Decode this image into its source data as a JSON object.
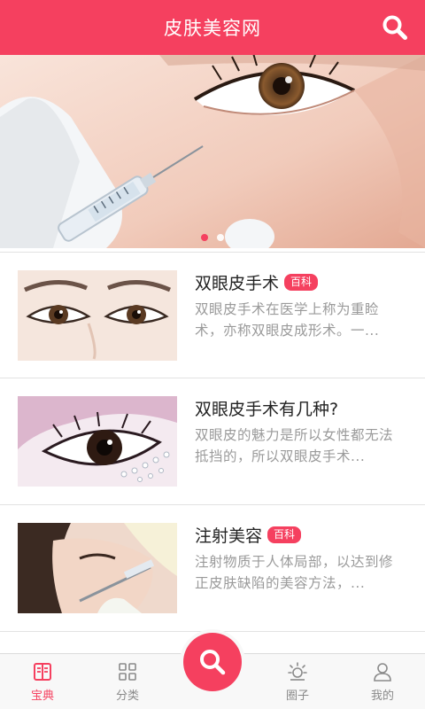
{
  "header": {
    "title": "皮肤美容网",
    "search_icon": "search-icon"
  },
  "banner": {
    "dots": 2,
    "active_index": 0
  },
  "articles": [
    {
      "title": "双眼皮手术",
      "badge": "百科",
      "desc": "双眼皮手术在医学上称为重睑术，亦称双眼皮成形术。一..."
    },
    {
      "title": "双眼皮手术有几种?",
      "badge": "",
      "desc": "双眼皮的魅力是所以女性都无法抵挡的，所以双眼皮手术..."
    },
    {
      "title": "注射美容",
      "badge": "百科",
      "desc": "注射物质于人体局部，以达到修正皮肤缺陷的美容方法，..."
    }
  ],
  "tabbar": {
    "tabs": [
      {
        "label": "宝典",
        "icon": "book-icon",
        "active": true
      },
      {
        "label": "分类",
        "icon": "grid-icon",
        "active": false
      },
      {
        "label": "圈子",
        "icon": "sun-icon",
        "active": false
      },
      {
        "label": "我的",
        "icon": "user-icon",
        "active": false
      }
    ],
    "center_icon": "search-icon"
  },
  "colors": {
    "accent": "#f5405f",
    "text": "#222222",
    "muted": "#9a9a9a"
  }
}
